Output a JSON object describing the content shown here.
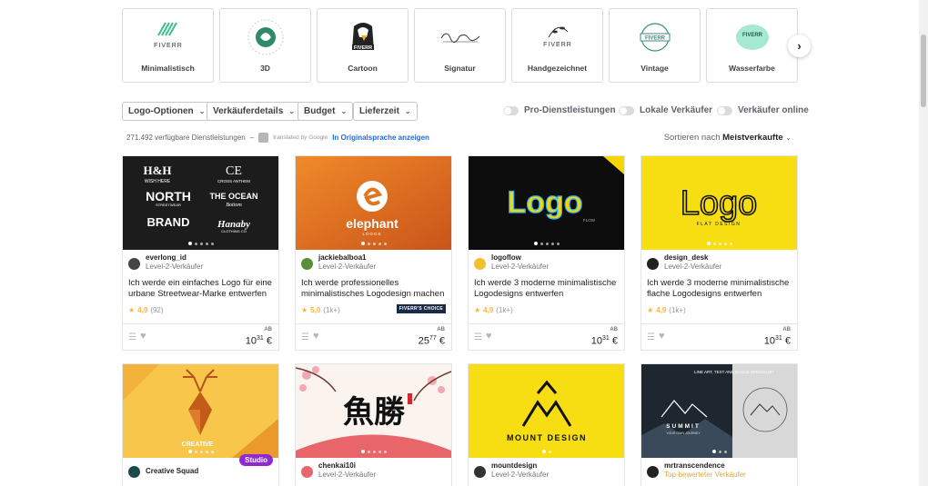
{
  "styles": {
    "items": [
      {
        "label": "Minimalistisch"
      },
      {
        "label": "3D"
      },
      {
        "label": "Cartoon"
      },
      {
        "label": "Signatur"
      },
      {
        "label": "Handgezeichnet"
      },
      {
        "label": "Vintage"
      },
      {
        "label": "Wasserfarbe"
      }
    ],
    "logo_text": "FIVERR"
  },
  "filters": {
    "logo_options": "Logo-Optionen",
    "seller_details": "Verkäuferdetails",
    "budget": "Budget",
    "delivery": "Lieferzeit"
  },
  "toggles": {
    "pro": "Pro-Dienstleistungen",
    "local": "Lokale Verkäufer",
    "online": "Verkäufer online"
  },
  "info": {
    "count": "271.492 verfügbare Dienstleistungen",
    "dash": "–",
    "translated": "translated by Google",
    "original": "In Originalsprache anzeigen"
  },
  "sort": {
    "label": "Sortieren nach",
    "value": "Meistverkaufte"
  },
  "gigs": [
    {
      "seller": "everlong_id",
      "level": "Level-2-Verkäufer",
      "title": "Ich werde ein einfaches Logo für eine urbane Streetwear-Marke entwerfen",
      "rating": "4,9",
      "reviews": "(92)",
      "ab": "AB",
      "price_main": "10",
      "price_sup": "31",
      "currency": "€"
    },
    {
      "seller": "jackiebalboa1",
      "level": "Level-2-Verkäufer",
      "title": "Ich werde professionelles minimalistisches Logodesign machen",
      "rating": "5,0",
      "reviews": "(1k+)",
      "badge": "FIVERR'S CHOICE",
      "ab": "AB",
      "price_main": "25",
      "price_sup": "77",
      "currency": "€"
    },
    {
      "seller": "logoflow",
      "level": "Level-2-Verkäufer",
      "title": "Ich werde 3 moderne minimalistische Logodesigns entwerfen",
      "rating": "4,9",
      "reviews": "(1k+)",
      "ab": "AB",
      "price_main": "10",
      "price_sup": "31",
      "currency": "€"
    },
    {
      "seller": "design_desk",
      "level": "Level-2-Verkäufer",
      "title": "Ich werde 3 moderne minimalistische flache Logodesigns entwerfen",
      "rating": "4,9",
      "reviews": "(1k+)",
      "ab": "AB",
      "price_main": "10",
      "price_sup": "31",
      "currency": "€"
    },
    {
      "seller": "Creative Squad",
      "level": "",
      "studio": "Studio"
    },
    {
      "seller": "chenkai10i",
      "level": "Level-2-Verkäufer"
    },
    {
      "seller": "mountdesign",
      "level": "Level-2-Verkäufer"
    },
    {
      "seller": "mrtranscendence",
      "level": "Top-bewerteter Verkäufer"
    }
  ],
  "image_text": {
    "g1_wish": "WISH HERE",
    "g1_north": "NORTH",
    "g1_street": "STREETWEAR",
    "g1_cross": "CROSS ANTHEM",
    "g1_ocean": "THE OCEAN",
    "g1_bottom": "Bottom",
    "g1_brand": "BRAND",
    "g1_hanaby": "Hanaby",
    "g1_clothing": "CLOTHING CO",
    "g2_brand": "elephant",
    "g2_sub": "LOGOS",
    "g3_logo": "Logo",
    "g3_flow": "FLOW",
    "g4_logo": "Logo",
    "g4_flat": "FLAT DESIGN",
    "g5_creative": "CREATIVE",
    "g7_mount": "MOUNT DESIGN",
    "g8_line": "LINE ART, TEXT AND BADGE SPECIALIST",
    "g8_summit": "SUMMIT",
    "g8_journey": "YOUR OWN JOURNEY"
  }
}
